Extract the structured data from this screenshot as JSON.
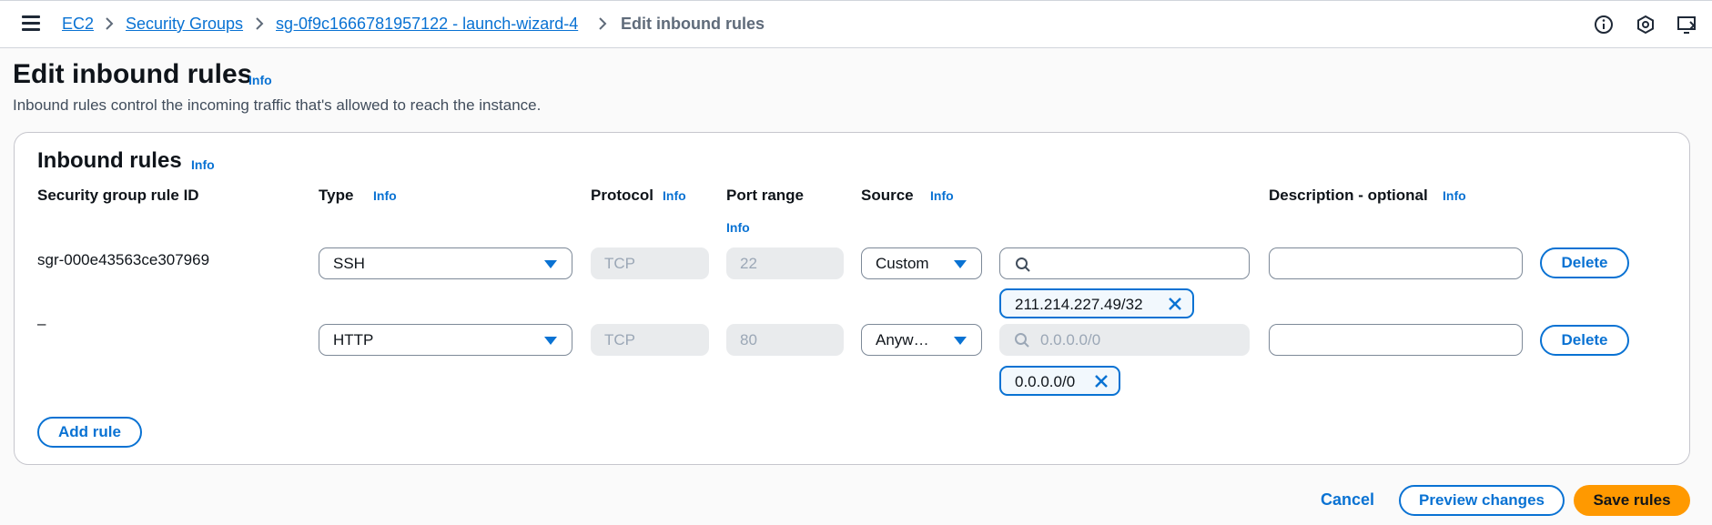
{
  "breadcrumb": {
    "items": [
      "EC2",
      "Security Groups",
      "sg-0f9c1666781957122 - launch-wizard-4"
    ],
    "current": "Edit inbound rules"
  },
  "page": {
    "title": "Edit inbound rules",
    "info": "Info",
    "description": "Inbound rules control the incoming traffic that's allowed to reach the instance."
  },
  "panel": {
    "title": "Inbound rules",
    "info": "Info",
    "columns": {
      "rule_id": "Security group rule ID",
      "type": "Type",
      "protocol": "Protocol",
      "port_range": "Port range",
      "source": "Source",
      "description": "Description - optional",
      "info": "Info"
    },
    "rules": [
      {
        "rule_id": "sgr-000e43563ce307969",
        "type": "SSH",
        "protocol": "TCP",
        "port_range": "22",
        "source_type": "Custom",
        "search_placeholder": "",
        "token": "211.214.227.49/32",
        "description": "",
        "delete_label": "Delete"
      },
      {
        "rule_id": "–",
        "type": "HTTP",
        "protocol": "TCP",
        "port_range": "80",
        "source_type": "Anyw…",
        "search_placeholder": "0.0.0.0/0",
        "token": "0.0.0.0/0",
        "description": "",
        "delete_label": "Delete"
      }
    ],
    "add_rule": "Add rule"
  },
  "footer": {
    "cancel": "Cancel",
    "preview": "Preview changes",
    "save": "Save rules"
  },
  "colors": {
    "accent": "#0972d3",
    "primary_button": "#ff9900"
  }
}
